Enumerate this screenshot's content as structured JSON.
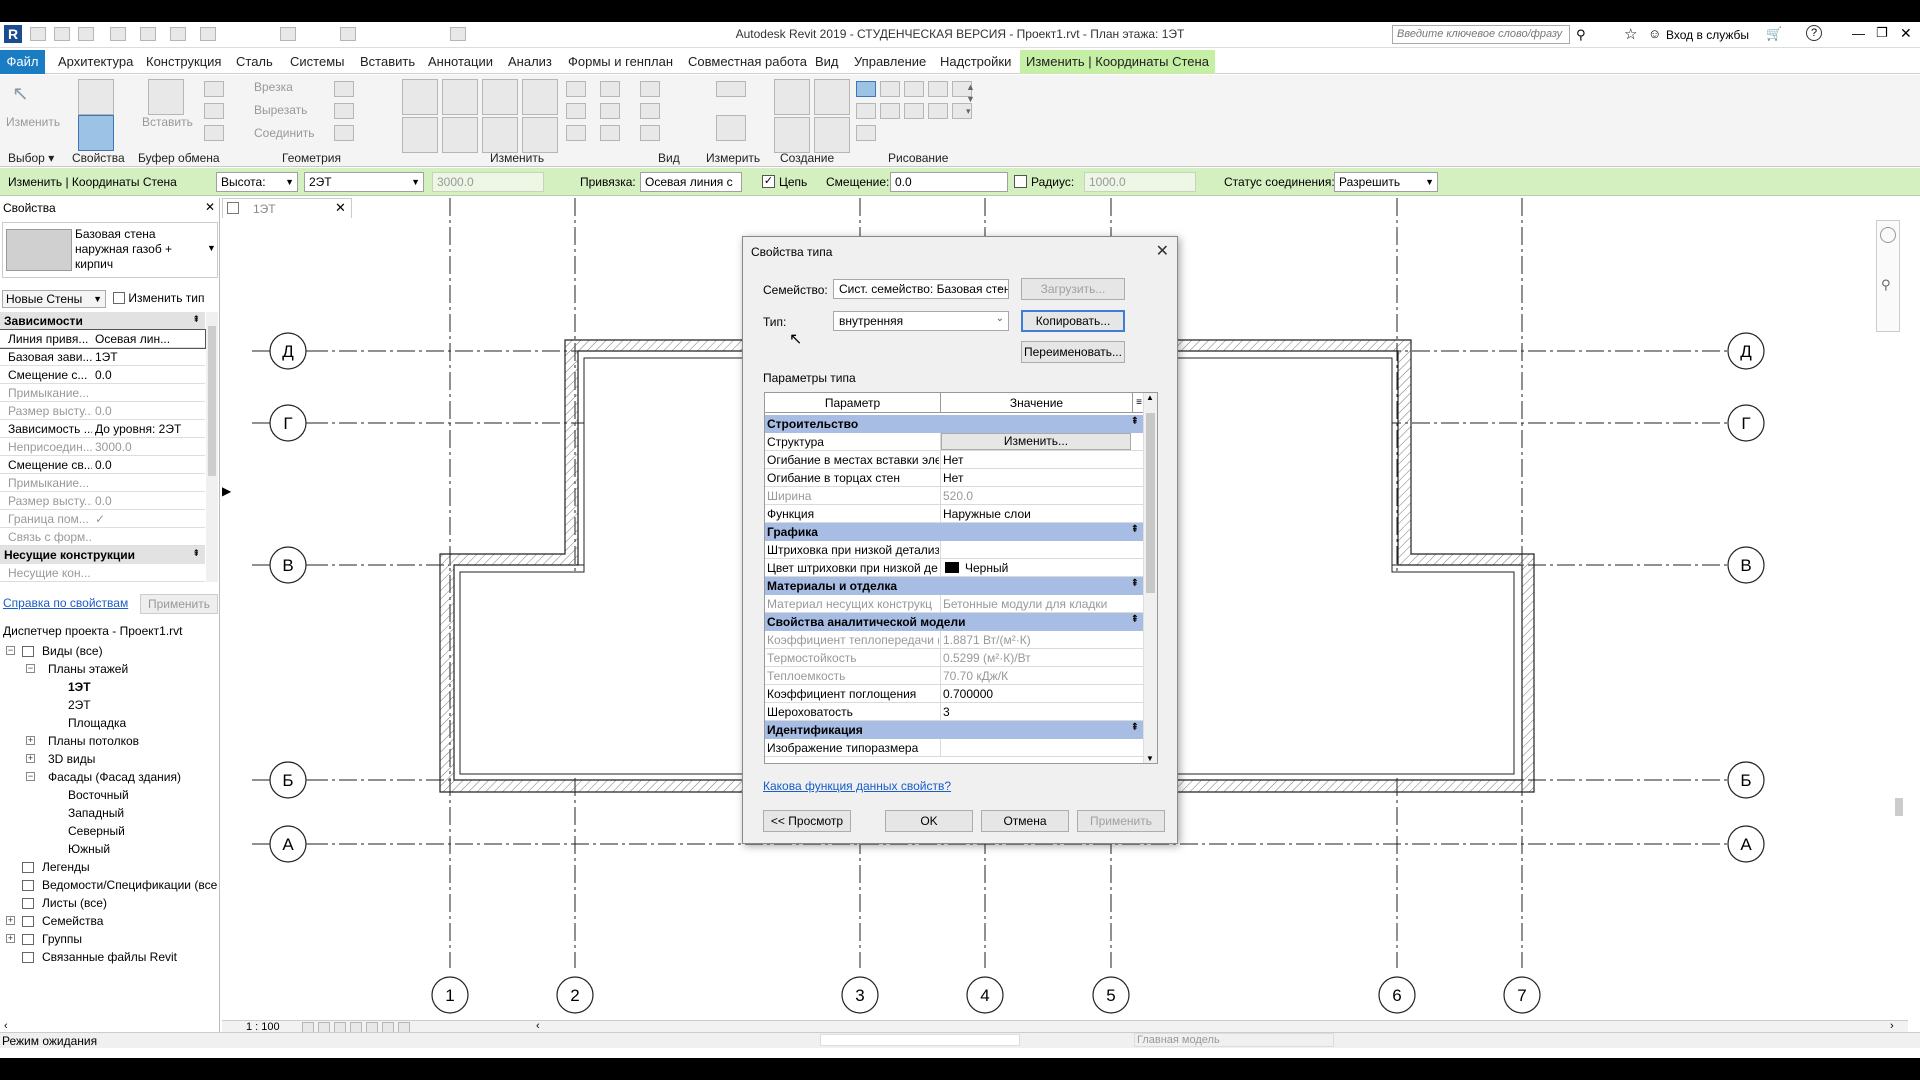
{
  "app": {
    "title": "Autodesk Revit 2019 - СТУДЕНЧЕСКАЯ ВЕРСИЯ - Проект1.rvt - План этажа: 1ЭТ",
    "search_placeholder": "Введите ключевое слово/фразу",
    "signin": "Вход в службы"
  },
  "tabs": [
    "Архитектура",
    "Конструкция",
    "Сталь",
    "Системы",
    "Вставить",
    "Аннотации",
    "Анализ",
    "Формы и генплан",
    "Совместная работа",
    "Вид",
    "Управление",
    "Надстройки"
  ],
  "tab_file": "Файл",
  "tab_active": "Изменить | Координаты Стена",
  "ribbon": {
    "modify": "Изменить",
    "paste": "Вставить",
    "cut_label": "Врезка",
    "cutout_label": "Вырезать",
    "join_label": "Соединить",
    "panels": {
      "select": "Выбор",
      "properties": "Свойства",
      "clipboard": "Буфер обмена",
      "geometry": "Геометрия",
      "modify": "Изменить",
      "view": "Вид",
      "measure": "Измерить",
      "create": "Создание",
      "draw": "Рисование"
    }
  },
  "optionsbar": {
    "context": "Изменить | Координаты Стена",
    "height_label": "Высота:",
    "level": "2ЭТ",
    "height_value": "3000.0",
    "snap_label": "Привязка:",
    "snap_value": "Осевая линия с",
    "chain": "Цепь",
    "offset_label": "Смещение:",
    "offset_value": "0.0",
    "radius": "Радиус:",
    "radius_value": "1000.0",
    "join_status_label": "Статус соединения:",
    "join_status_value": "Разрешить"
  },
  "properties": {
    "header": "Свойства",
    "type_name": "Базовая стена наружная газоб + кирпич",
    "instance_filter": "Новые Стены",
    "edit_type": "Изменить тип",
    "groups": [
      {
        "name": "Зависимости"
      },
      {
        "name": "Несущие конструкции"
      }
    ],
    "rows": [
      {
        "k": "Линия привя...",
        "v": "Осевая лин..."
      },
      {
        "k": "Базовая зави...",
        "v": "1ЭТ"
      },
      {
        "k": "Смещение с...",
        "v": "0.0"
      },
      {
        "k": "Примыкание...",
        "v": ""
      },
      {
        "k": "Размер высту...",
        "v": "0.0"
      },
      {
        "k": "Зависимость ...",
        "v": "До уровня: 2ЭТ"
      },
      {
        "k": "Неприсоедин...",
        "v": "3000.0"
      },
      {
        "k": "Смещение св...",
        "v": "0.0"
      },
      {
        "k": "Примыкание...",
        "v": ""
      },
      {
        "k": "Размер высту...",
        "v": "0.0"
      },
      {
        "k": "Граница пом...",
        "v": "✓"
      },
      {
        "k": "Связь с форм...",
        "v": ""
      }
    ],
    "row_bearing": {
      "k": "Несущие кон...",
      "v": ""
    },
    "help_link": "Справка по свойствам",
    "apply": "Применить"
  },
  "browser": {
    "title": "Диспетчер проекта - Проект1.rvt",
    "items": [
      {
        "label": "Виды (все)",
        "level": 0,
        "toggle": "−"
      },
      {
        "label": "Планы этажей",
        "level": 1,
        "toggle": "−"
      },
      {
        "label": "1ЭТ",
        "level": 2,
        "toggle": ""
      },
      {
        "label": "2ЭТ",
        "level": 2,
        "toggle": ""
      },
      {
        "label": "Площадка",
        "level": 2,
        "toggle": ""
      },
      {
        "label": "Планы потолков",
        "level": 1,
        "toggle": "+"
      },
      {
        "label": "3D виды",
        "level": 1,
        "toggle": "+"
      },
      {
        "label": "Фасады (Фасад здания)",
        "level": 1,
        "toggle": "−"
      },
      {
        "label": "Восточный",
        "level": 2,
        "toggle": ""
      },
      {
        "label": "Западный",
        "level": 2,
        "toggle": ""
      },
      {
        "label": "Северный",
        "level": 2,
        "toggle": ""
      },
      {
        "label": "Южный",
        "level": 2,
        "toggle": ""
      },
      {
        "label": "Легенды",
        "level": 0,
        "toggle": ""
      },
      {
        "label": "Ведомости/Спецификации (все",
        "level": 0,
        "toggle": ""
      },
      {
        "label": "Листы (все)",
        "level": 0,
        "toggle": ""
      },
      {
        "label": "Семейства",
        "level": 0,
        "toggle": "+"
      },
      {
        "label": "Группы",
        "level": 0,
        "toggle": "+"
      },
      {
        "label": "Связанные файлы Revit",
        "level": 0,
        "toggle": ""
      }
    ]
  },
  "view": {
    "tab": "1ЭТ",
    "grid_letters": [
      "Д",
      "Г",
      "В",
      "Б",
      "А"
    ],
    "grid_numbers": [
      "1",
      "2",
      "3",
      "4",
      "5",
      "6",
      "7"
    ],
    "scale": "1 : 100"
  },
  "status": {
    "text": "Режим ожидания",
    "model": "Главная модель"
  },
  "dialog": {
    "title": "Свойства типа",
    "family_label": "Семейство:",
    "family_value": "Сист. семейство: Базовая стена",
    "load": "Загрузить...",
    "type_label": "Тип:",
    "type_value": "внутренняя",
    "duplicate": "Копировать...",
    "rename": "Переименовать...",
    "params_label": "Параметры типа",
    "col_param": "Параметр",
    "col_value": "Значение",
    "groups": {
      "construction": "Строительство",
      "graphics": "Графика",
      "materials": "Материалы и отделка",
      "analytical": "Свойства аналитической модели",
      "identity": "Идентификация"
    },
    "rows_construction": [
      {
        "k": "Структура",
        "v": "Изменить..."
      },
      {
        "k": "Огибание в местах вставки эле",
        "v": "Нет"
      },
      {
        "k": "Огибание в торцах стен",
        "v": "Нет"
      },
      {
        "k": "Ширина",
        "v": "520.0"
      },
      {
        "k": "Функция",
        "v": "Наружные слои"
      }
    ],
    "rows_graphics": [
      {
        "k": "Штриховка при низкой детализ",
        "v": ""
      },
      {
        "k": "Цвет штриховки при низкой де",
        "v": "Черный"
      }
    ],
    "rows_materials": [
      {
        "k": "Материал несущих конструкц",
        "v": "Бетонные модули для кладки"
      }
    ],
    "rows_analytical": [
      {
        "k": "Коэффициент теплопередачи (",
        "v": "1.8871 Вт/(м²·К)"
      },
      {
        "k": "Термостойкость",
        "v": "0.5299 (м²·К)/Вт"
      },
      {
        "k": "Теплоемкость",
        "v": "70.70 кДж/К"
      },
      {
        "k": "Коэффициент поглощения",
        "v": "0.700000"
      },
      {
        "k": "Шероховатость",
        "v": "3"
      }
    ],
    "rows_identity": [
      {
        "k": "Изображение типоразмера",
        "v": ""
      }
    ],
    "help_link": "Какова функция данных свойств?",
    "preview": "<< Просмотр",
    "ok": "OK",
    "cancel": "Отмена",
    "apply": "Применить"
  },
  "colors": {
    "accent": "#1a7dc4",
    "context_tab": "#c6efa6",
    "options_bar": "#d5f0c0",
    "grid_group": "#a7bde4"
  }
}
